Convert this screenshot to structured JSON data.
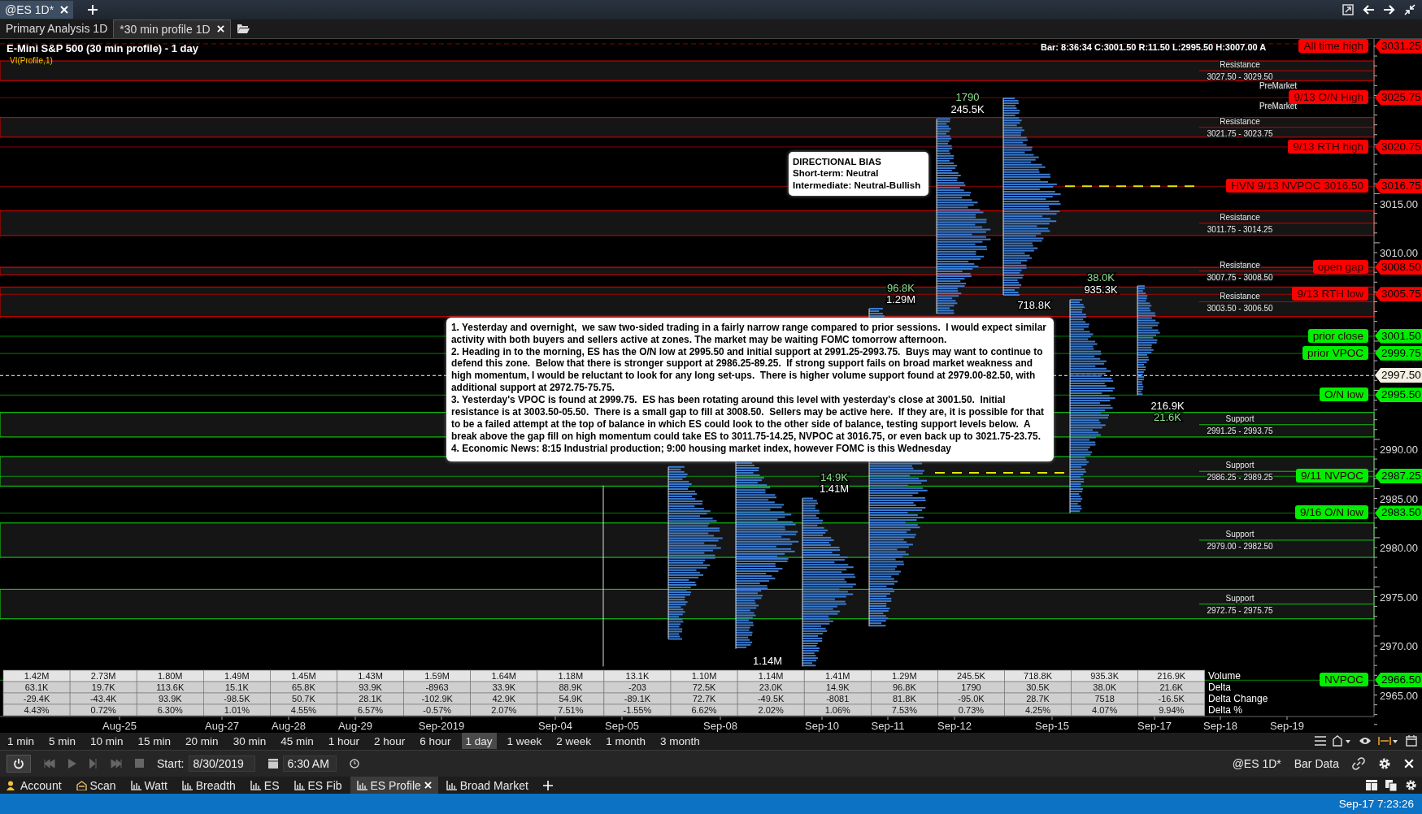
{
  "window_tabs": [
    {
      "label": "@ES 1D*",
      "selected": true
    }
  ],
  "chart_tabs": [
    {
      "label": "Primary Analysis 1D",
      "selected": false
    },
    {
      "label": "*30 min profile 1D",
      "selected": true
    }
  ],
  "chart": {
    "title": "E-Mini S&P 500 (30 min profile) - 1 day",
    "indicator": "VI(Profile,1)",
    "bar_info": "Bar: 8:36:34 C:3001.50 R:11.50 L:2995.50 H:3007.00 A",
    "price_ticks": [
      "3015.00",
      "3010.00",
      "2990.00",
      "2985.00",
      "2980.00",
      "2975.00",
      "2970.00",
      "2965.00"
    ],
    "zones": [
      {
        "kind": "resistance",
        "label": "Resistance",
        "range": "3027.50 - 3029.50"
      },
      {
        "kind": "resistance",
        "label": "Resistance",
        "range": "3021.75 - 3023.75"
      },
      {
        "kind": "resistance",
        "label": "Resistance",
        "range": "3011.75 - 3014.25"
      },
      {
        "kind": "resistance",
        "label": "Resistance",
        "range": "3007.75 - 3008.50"
      },
      {
        "kind": "resistance",
        "label": "Resistance",
        "range": "3003.50 - 3006.50"
      },
      {
        "kind": "support",
        "label": "Support",
        "range": "2991.25 - 2993.75"
      },
      {
        "kind": "support",
        "label": "Support",
        "range": "2986.25 - 2989.25"
      },
      {
        "kind": "support",
        "label": "Support",
        "range": "2979.00 - 2982.50"
      },
      {
        "kind": "support",
        "label": "Support",
        "range": "2972.75 - 2975.75"
      }
    ],
    "session_labels": [
      "PreMarket",
      "PreMarket"
    ],
    "levels": [
      {
        "label": "All time high",
        "value": "3031.25",
        "color": "#ff0000"
      },
      {
        "label": "9/13 O/N High",
        "value": "3025.75",
        "color": "#ff0000"
      },
      {
        "label": "9/13 RTH high",
        "value": "3020.75",
        "color": "#ff0000"
      },
      {
        "label": "HVN 9/13 NVPOC 3016.50",
        "value": "3016.75",
        "color": "#ff0000"
      },
      {
        "label": "open gap",
        "value": "3008.50",
        "color": "#ff0000"
      },
      {
        "label": "9/13 RTH low",
        "value": "3005.75",
        "color": "#ff0000"
      },
      {
        "label": "prior close",
        "value": "3001.50",
        "color": "#00ee00"
      },
      {
        "label": "prior VPOC",
        "value": "2999.75",
        "color": "#00ee00"
      },
      {
        "label": "O/N low",
        "value": "2995.50",
        "color": "#00ee00"
      },
      {
        "label": "9/11 NVPOC",
        "value": "2987.25",
        "color": "#00ee00"
      },
      {
        "label": "9/16 O/N low",
        "value": "2983.50",
        "color": "#00ee00"
      },
      {
        "label": "NVPOC",
        "value": "2966.50",
        "color": "#00ee00"
      }
    ],
    "current_price": "2997.50",
    "profile_labels": [
      {
        "text": "1790",
        "kind": "delta"
      },
      {
        "text": "245.5K",
        "kind": "volume"
      },
      {
        "text": "38.0K",
        "kind": "delta"
      },
      {
        "text": "96.8K",
        "kind": "delta"
      },
      {
        "text": "935.3K",
        "kind": "volume"
      },
      {
        "text": "1.29M",
        "kind": "volume"
      },
      {
        "text": "718.8K",
        "kind": "volume"
      },
      {
        "text": "216.9K",
        "kind": "volume"
      },
      {
        "text": "21.6K",
        "kind": "delta"
      },
      {
        "text": "14.9K",
        "kind": "delta"
      },
      {
        "text": "1.41M",
        "kind": "volume"
      },
      {
        "text": "1.14M",
        "kind": "volume"
      }
    ],
    "bias_note": {
      "title": "DIRECTIONAL BIAS",
      "lines": [
        "Short-term: Neutral",
        "Intermediate: Neutral-Bullish"
      ]
    },
    "note": [
      "1. Yesterday and overnight,  we saw two-sided trading in a fairly narrow range compared to prior sessions.  I would expect similar activity with both buyers and sellers active at zones. The market may be waiting FOMC tomorrow afternoon.",
      "2. Heading in to the morning, ES has the O/N low at 2995.50 and initial support at 2991.25-2993.75.  Buys may want to continue to defend this zone.  Below that there is stronger support at 2986.25-89.25.  If strong support fails on broad market weakness and high momentum, I would be reluctant to look for any long set-ups.  There is higher volume support found at 2979.00-82.50, with additional support at 2972.75-75.75.",
      "3. Yesterday's VPOC is found at 2999.75.  ES has been rotating around this level with yesterday's close at 3001.50.  Initial resistance is at 3003.50-05.50.  There is a small gap to fill at 3008.50.  Sellers may be active here.  If they are, it is possible for that to be a failed attempt at the top of balance in which ES could look to the other side of balance, testing support levels below.  A break above the gap fill on high momentum could take ES to 3011.75-14.25, NVPOC at 3016.75, or even back up to 3021.75-23.75.",
      "4. Economic News: 8:15 Industrial production; 9:00 housing market index, however FOMC is this Wednesday"
    ],
    "stats_table": {
      "rows": [
        {
          "label": "Volume",
          "cells": [
            "1.42M",
            "2.73M",
            "1.80M",
            "1.49M",
            "1.45M",
            "1.43M",
            "1.59M",
            "1.64M",
            "1.18M",
            "13.1K",
            "1.10M",
            "1.14M",
            "1.41M",
            "1.29M",
            "245.5K",
            "718.8K",
            "935.3K",
            "216.9K"
          ]
        },
        {
          "label": "Delta",
          "cells": [
            "63.1K",
            "19.7K",
            "113.6K",
            "15.1K",
            "65.8K",
            "93.9K",
            "-8963",
            "33.9K",
            "88.9K",
            "-203",
            "72.5K",
            "23.0K",
            "14.9K",
            "96.8K",
            "1790",
            "30.5K",
            "38.0K",
            "21.6K"
          ]
        },
        {
          "label": "Delta Change",
          "cells": [
            "-29.4K",
            "-43.4K",
            "93.9K",
            "-98.5K",
            "50.7K",
            "28.1K",
            "-102.9K",
            "42.9K",
            "54.9K",
            "-89.1K",
            "72.7K",
            "-49.5K",
            "-8081",
            "81.8K",
            "-95.0K",
            "28.7K",
            "7518",
            "-16.5K"
          ]
        },
        {
          "label": "Delta %",
          "cells": [
            "4.43%",
            "0.72%",
            "6.30%",
            "1.01%",
            "4.55%",
            "6.57%",
            "-0.57%",
            "2.07%",
            "7.51%",
            "-1.55%",
            "6.62%",
            "2.02%",
            "1.06%",
            "7.53%",
            "0.73%",
            "4.25%",
            "4.07%",
            "9.94%"
          ]
        }
      ]
    },
    "dates": [
      "Aug-25",
      "Aug-27",
      "Aug-28",
      "Aug-29",
      "Sep-2019",
      "Sep-04",
      "Sep-05",
      "Sep-08",
      "Sep-10",
      "Sep-11",
      "Sep-12",
      "Sep-15",
      "Sep-17",
      "Sep-18",
      "Sep-19"
    ]
  },
  "intervals": [
    {
      "label": "1 min",
      "selected": false
    },
    {
      "label": "5 min",
      "selected": false
    },
    {
      "label": "10 min",
      "selected": false
    },
    {
      "label": "15 min",
      "selected": false
    },
    {
      "label": "20 min",
      "selected": false
    },
    {
      "label": "30 min",
      "selected": false
    },
    {
      "label": "45 min",
      "selected": false
    },
    {
      "label": "1 hour",
      "selected": false
    },
    {
      "label": "2 hour",
      "selected": false
    },
    {
      "label": "6 hour",
      "selected": false
    },
    {
      "label": "1 day",
      "selected": true
    },
    {
      "label": "1 week",
      "selected": false
    },
    {
      "label": "2 week",
      "selected": false
    },
    {
      "label": "1 month",
      "selected": false
    },
    {
      "label": "3 month",
      "selected": false
    }
  ],
  "playback": {
    "start_label": "Start:",
    "date": "8/30/2019",
    "time": "6:30 AM",
    "symbol": "@ES 1D*",
    "data_label": "Bar Data"
  },
  "workspace_tabs": [
    {
      "label": "Account",
      "selected": false
    },
    {
      "label": "Scan",
      "selected": false
    },
    {
      "label": "Watt",
      "selected": false
    },
    {
      "label": "Breadth",
      "selected": false
    },
    {
      "label": "ES",
      "selected": false
    },
    {
      "label": "ES Fib",
      "selected": false
    },
    {
      "label": "ES Profile",
      "selected": true
    },
    {
      "label": "Broad Market",
      "selected": false
    }
  ],
  "status_bar": {
    "time": "Sep-17 7:23:26"
  }
}
